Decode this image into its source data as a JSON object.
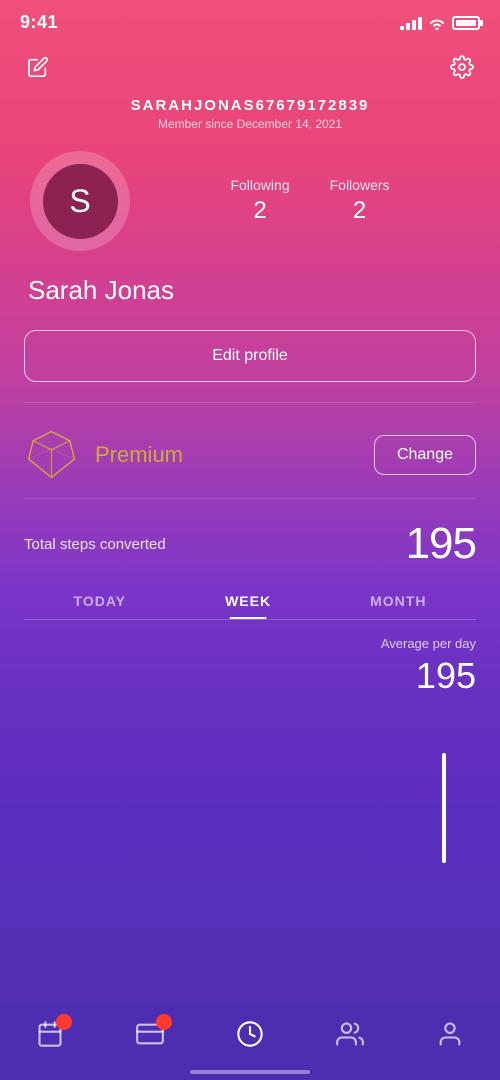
{
  "status": {
    "time": "9:41"
  },
  "header": {
    "username": "SARAHJONAS67679172839",
    "member_since": "Member since December 14, 2021",
    "edit_icon": "✏",
    "settings_icon": "⚙"
  },
  "profile": {
    "avatar_letter": "S",
    "display_name": "Sarah Jonas",
    "following_label": "Following",
    "following_count": "2",
    "followers_label": "Followers",
    "followers_count": "2"
  },
  "actions": {
    "edit_profile": "Edit profile",
    "change": "Change"
  },
  "premium": {
    "label": "Premium"
  },
  "stats": {
    "total_steps_label": "Total steps converted",
    "total_steps_value": "195",
    "avg_per_day_label": "Average per day",
    "avg_per_day_value": "195"
  },
  "tabs": [
    {
      "id": "today",
      "label": "TODAY",
      "active": false
    },
    {
      "id": "week",
      "label": "WEEK",
      "active": true
    },
    {
      "id": "month",
      "label": "MONTH",
      "active": false
    }
  ],
  "nav": [
    {
      "id": "calendar",
      "icon": "🗓",
      "badge": true
    },
    {
      "id": "wallet",
      "icon": "💳",
      "badge": true
    },
    {
      "id": "gauge",
      "icon": "⚡",
      "badge": false,
      "active": true
    },
    {
      "id": "users",
      "icon": "👥",
      "badge": false
    },
    {
      "id": "profile",
      "icon": "👤",
      "badge": false
    }
  ]
}
